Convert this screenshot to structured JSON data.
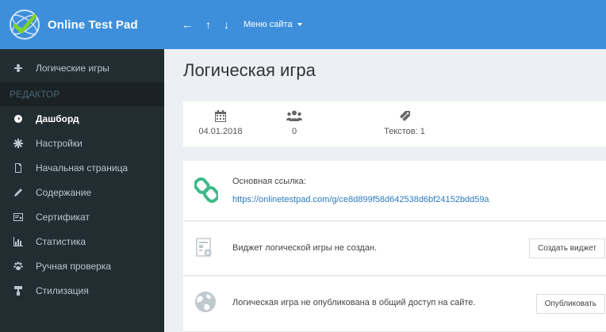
{
  "app": {
    "name": "Online Test Pad"
  },
  "topbar": {
    "back_arrow": "←",
    "up_arrow": "↑",
    "down_arrow": "↓",
    "menu_label": "Меню сайта"
  },
  "sidebar": {
    "top_item": "Логические игры",
    "section_label": "РЕДАКТОР",
    "items": [
      {
        "label": "Дашборд",
        "icon": "dashboard-icon",
        "active": true
      },
      {
        "label": "Настройки",
        "icon": "gear-icon",
        "active": false
      },
      {
        "label": "Начальная страница",
        "icon": "file-icon",
        "active": false
      },
      {
        "label": "Содержание",
        "icon": "pencil-icon",
        "active": false
      },
      {
        "label": "Сертификат",
        "icon": "certificate-icon",
        "active": false
      },
      {
        "label": "Статистика",
        "icon": "bar-chart-icon",
        "active": false
      },
      {
        "label": "Ручная проверка",
        "icon": "paw-icon",
        "active": false
      },
      {
        "label": "Стилизация",
        "icon": "paint-icon",
        "active": false
      }
    ]
  },
  "main": {
    "page_title": "Логическая игра",
    "stats": {
      "date": "04.01.2018",
      "users": "0",
      "texts": "Текстов: 1"
    },
    "link_card": {
      "label": "Основная ссылка:",
      "url": "https://onlinetestpad.com/g/ce8d899f58d642538d6bf24152bdd59a"
    },
    "widget_card": {
      "text": "Виджет логической игры не создан.",
      "button": "Создать виджет"
    },
    "publish_card": {
      "text": "Логическая игра не опубликована в общий доступ на сайте.",
      "button": "Опубликовать"
    }
  },
  "colors": {
    "header_blue": "#3d8fdc",
    "sidebar_dark": "#222d32",
    "sidebar_section": "#1a2226",
    "link_blue": "#2b7bc0",
    "chain_green": "#3fba8a",
    "background": "#ecf0f5"
  }
}
